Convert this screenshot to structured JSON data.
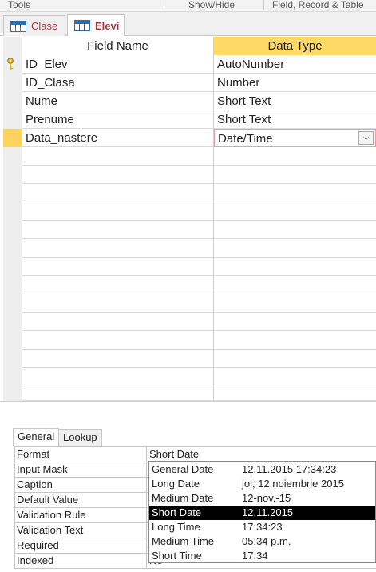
{
  "ribbon": {
    "groups": [
      "Tools",
      "Show/Hide",
      "Field, Record & Table"
    ]
  },
  "tabs": [
    {
      "label": "Clase",
      "active": false
    },
    {
      "label": "Elevi",
      "active": true
    }
  ],
  "grid": {
    "headers": {
      "field_name": "Field Name",
      "data_type": "Data Type"
    },
    "rows": [
      {
        "name": "ID_Elev",
        "type": "AutoNumber",
        "primary_key": true
      },
      {
        "name": "ID_Clasa",
        "type": "Number"
      },
      {
        "name": "Nume",
        "type": "Short Text"
      },
      {
        "name": "Prenume",
        "type": "Short Text"
      },
      {
        "name": "Data_nastere",
        "type": "Date/Time",
        "current": true
      }
    ],
    "dropdown_glyph": "⌵"
  },
  "properties": {
    "tabs": [
      "General",
      "Lookup"
    ],
    "rows": [
      {
        "label": "Format",
        "value": "Short Date"
      },
      {
        "label": "Input Mask",
        "value": ""
      },
      {
        "label": "Caption",
        "value": ""
      },
      {
        "label": "Default Value",
        "value": ""
      },
      {
        "label": "Validation Rule",
        "value": ""
      },
      {
        "label": "Validation Text",
        "value": ""
      },
      {
        "label": "Required",
        "value": ""
      },
      {
        "label": "Indexed",
        "value": "No"
      }
    ]
  },
  "format_options": [
    {
      "name": "General Date",
      "example": "12.11.2015 17:34:23"
    },
    {
      "name": "Long Date",
      "example": "joi, 12 noiembrie 2015"
    },
    {
      "name": "Medium Date",
      "example": "12-nov.-15"
    },
    {
      "name": "Short Date",
      "example": "12.11.2015",
      "selected": true
    },
    {
      "name": "Long Time",
      "example": "17:34:23"
    },
    {
      "name": "Medium Time",
      "example": "05:34 p.m."
    },
    {
      "name": "Short Time",
      "example": "17:34"
    }
  ],
  "colors": {
    "header_accent": "#ffd966",
    "tab_text": "#a4373a",
    "selection": "#000000"
  }
}
